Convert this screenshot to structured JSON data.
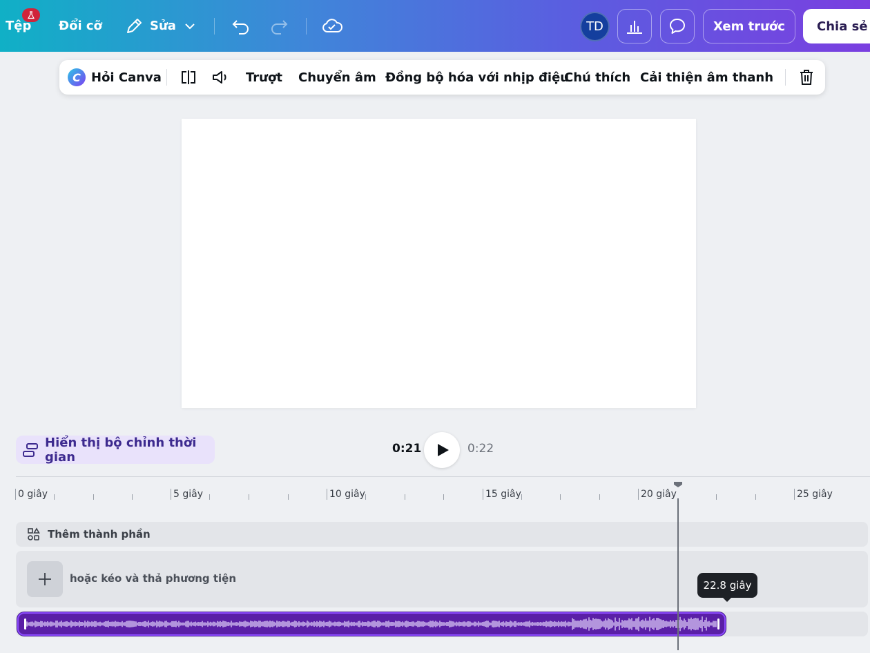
{
  "topbar": {
    "file_label": "Tệp",
    "resize_label": "Đổi cỡ",
    "edit_label": "Sửa",
    "avatar_initials": "TD",
    "preview_label": "Xem trước",
    "share_label": "Chia sẻ",
    "icons": [
      "lab-flask-icon",
      "pencil-icon",
      "chevron-down-icon",
      "undo-icon",
      "redo-icon",
      "cloud-check-icon",
      "bar-chart-icon",
      "comment-icon"
    ]
  },
  "context_toolbar": {
    "ask_canva_label": "Hỏi Canva",
    "slide_label": "Trượt",
    "transcribe_label": "Chuyển âm",
    "beat_sync_label": "Đồng bộ hóa với nhịp điệu",
    "captions_label": "Chú thích",
    "enhance_audio_label": "Cải thiện âm thanh",
    "icons": [
      "split-icon",
      "volume-icon",
      "trash-icon"
    ]
  },
  "playback": {
    "timer_toggle_label": "Hiển thị bộ chỉnh thời gian",
    "current_time": "0:21",
    "total_time": "0:22"
  },
  "ruler": {
    "labels": [
      "0 giây",
      "5 giây",
      "10 giây",
      "15 giây",
      "20 giây",
      "25 giây"
    ]
  },
  "tracks": {
    "add_elements_label": "Thêm thành phần",
    "drag_media_label": "hoặc kéo và thả phương tiện"
  },
  "tooltip": {
    "duration": "22.8 giây"
  },
  "colors": {
    "gradient_start": "#10b0c6",
    "gradient_end": "#7a3fe0",
    "audio_clip": "#5a1fa6",
    "accent_purple": "#8e4dff"
  }
}
